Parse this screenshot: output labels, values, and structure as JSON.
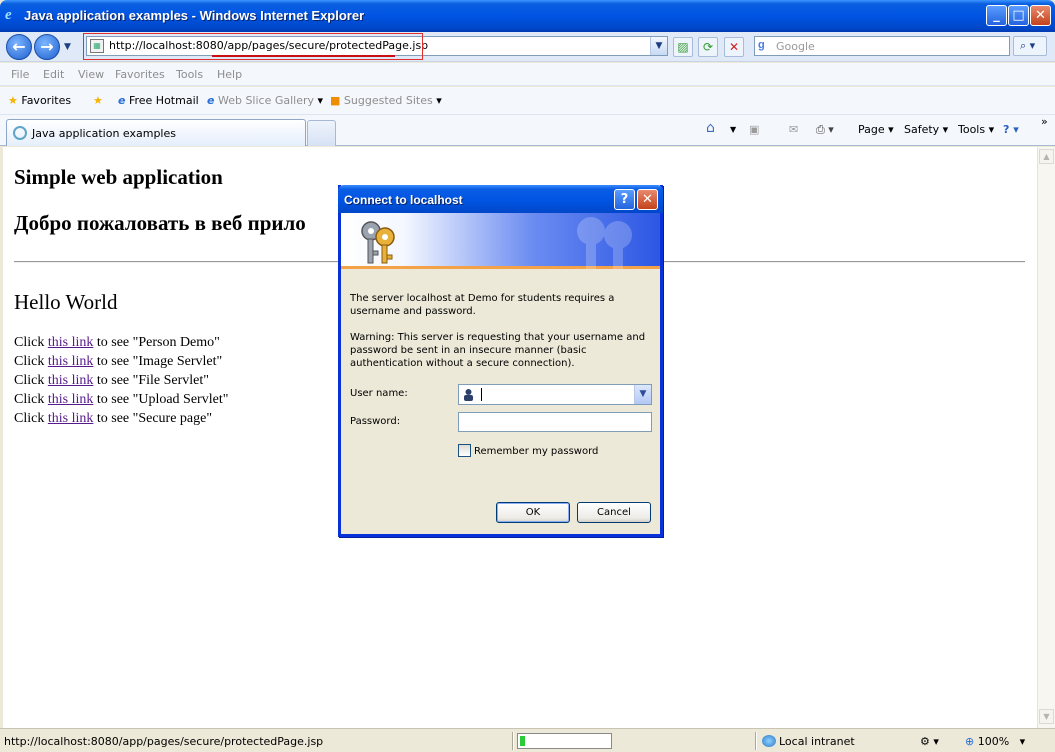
{
  "window": {
    "title": "Java application examples - Windows Internet Explorer"
  },
  "nav": {
    "address_url": "http://localhost:8080/app/pages/secure/protectedPage.jsp",
    "search_placeholder": "Google"
  },
  "menu": [
    "File",
    "Edit",
    "View",
    "Favorites",
    "Tools",
    "Help"
  ],
  "favorites_bar": {
    "favorites_label": "Favorites",
    "items": [
      "Free Hotmail",
      "Web Slice Gallery",
      "Suggested Sites"
    ]
  },
  "tab": {
    "title": "Java application examples"
  },
  "command_bar": {
    "page": "Page",
    "safety": "Safety",
    "tools": "Tools"
  },
  "page": {
    "heading1": "Simple web application",
    "heading2": "Добро пожаловать в веб прило",
    "heading3": "Hello World",
    "links": [
      {
        "prefix": "Click ",
        "link": "this link",
        "suffix": " to see \"Person Demo\""
      },
      {
        "prefix": "Click ",
        "link": "this link",
        "suffix": " to see \"Image Servlet\""
      },
      {
        "prefix": "Click ",
        "link": "this link",
        "suffix": " to see \"File Servlet\""
      },
      {
        "prefix": "Click ",
        "link": "this link",
        "suffix": " to see \"Upload Servlet\""
      },
      {
        "prefix": "Click ",
        "link": "this link",
        "suffix": " to see \"Secure page\""
      }
    ]
  },
  "dialog": {
    "title": "Connect to localhost",
    "message": "The server localhost at Demo for students requires a username and password.",
    "warning": "Warning: This server is requesting that your username and password be sent in an insecure manner (basic authentication without a secure connection).",
    "username_label": "User name:",
    "password_label": "Password:",
    "remember_label": "Remember my password",
    "ok": "OK",
    "cancel": "Cancel"
  },
  "status": {
    "text": "http://localhost:8080/app/pages/secure/protectedPage.jsp",
    "zone": "Local intranet",
    "zoom": "100%",
    "progress": 0.06
  }
}
